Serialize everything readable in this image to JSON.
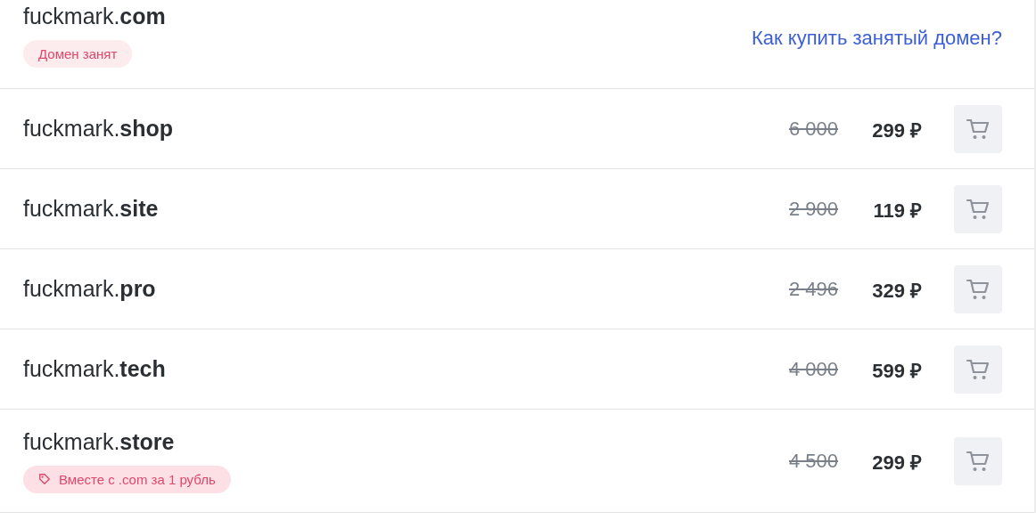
{
  "domains": [
    {
      "kind": "taken",
      "name": "fuckmark.**com**",
      "badge": "Домен занят",
      "link": "Как купить занятый домен?"
    },
    {
      "kind": "available",
      "name": "fuckmark.**shop**",
      "old_price": "6 000",
      "price": "299 ₽"
    },
    {
      "kind": "available",
      "name": "fuckmark.**site**",
      "old_price": "2 900",
      "price": "119 ₽"
    },
    {
      "kind": "available",
      "name": "fuckmark.**pro**",
      "old_price": "2 496",
      "price": "329 ₽"
    },
    {
      "kind": "available",
      "name": "fuckmark.**tech**",
      "old_price": "4 000",
      "price": "599 ₽"
    },
    {
      "kind": "available",
      "name": "fuckmark.**store**",
      "promo": "Вместе с .com за 1 рубль",
      "old_price": "4 500",
      "price": "299 ₽"
    }
  ]
}
